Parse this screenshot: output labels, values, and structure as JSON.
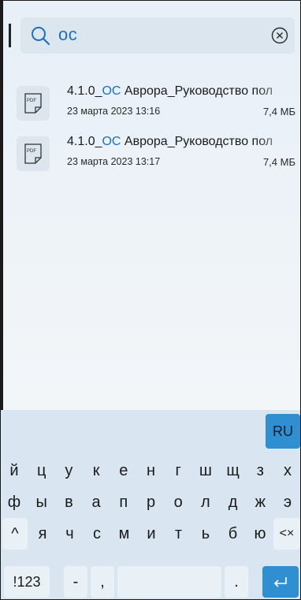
{
  "search": {
    "query": "ос"
  },
  "files": [
    {
      "name_prefix": "4.1.0_",
      "name_match": "ОС",
      "name_rest": " Аврора_Руководство пол",
      "date": "23 марта 2023 13:16",
      "size": "7,4 МБ",
      "type_label": "PDF"
    },
    {
      "name_prefix": "4.1.0_",
      "name_match": "ОС",
      "name_rest": " Аврора_Руководство пол",
      "date": "23 марта 2023 13:17",
      "size": "7,4 МБ",
      "type_label": "PDF"
    }
  ],
  "keyboard": {
    "language": "RU",
    "row1": [
      "й",
      "ц",
      "у",
      "к",
      "е",
      "н",
      "г",
      "ш",
      "щ",
      "з",
      "х"
    ],
    "row2": [
      "ф",
      "ы",
      "в",
      "а",
      "п",
      "р",
      "о",
      "л",
      "д",
      "ж",
      "э"
    ],
    "row3": [
      "я",
      "ч",
      "с",
      "м",
      "и",
      "т",
      "ь",
      "б",
      "ю"
    ],
    "shift_label": "^",
    "backspace_label": "<×",
    "numbers_label": "!123",
    "dash_label": "-",
    "comma_label": ",",
    "period_label": ".",
    "accent_color": "#2f8fd0"
  }
}
